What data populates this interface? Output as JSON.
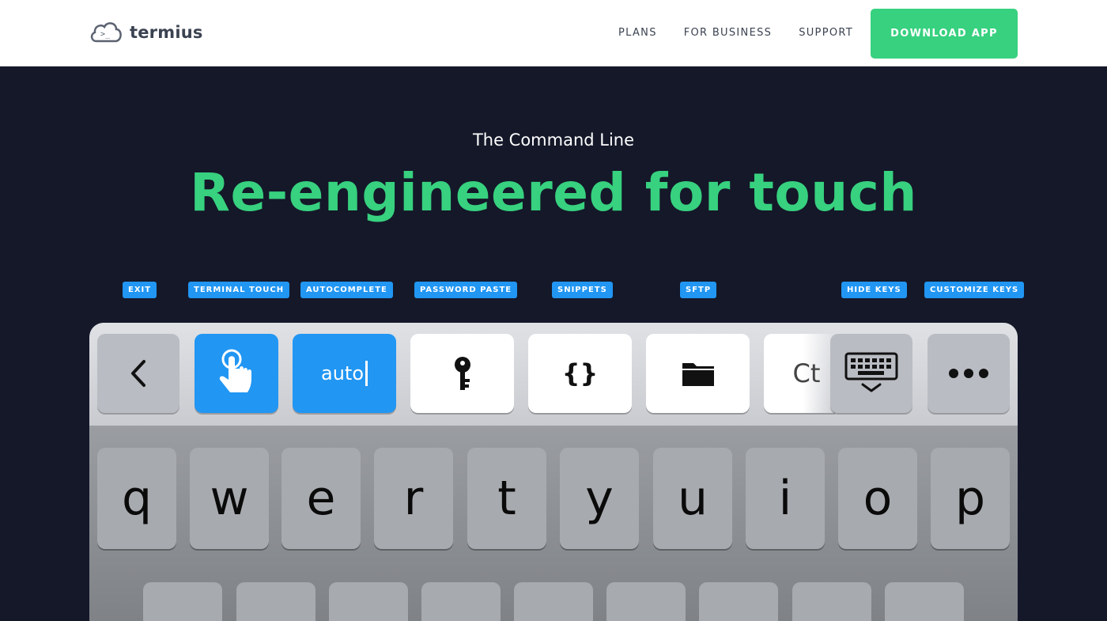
{
  "header": {
    "logo_text": "termius",
    "nav": [
      "PLANS",
      "FOR BUSINESS",
      "SUPPORT"
    ],
    "cta": "DOWNLOAD APP"
  },
  "hero": {
    "eyebrow": "The Command Line",
    "title": "Re-engineered for touch"
  },
  "feature_tags": [
    "EXIT",
    "TERMINAL TOUCH",
    "AUTOCOMPLETE",
    "PASSWORD PASTE",
    "SNIPPETS",
    "SFTP",
    "HIDE KEYS",
    "CUSTOMIZE KEYS"
  ],
  "accessory_keys": {
    "back_icon": "chevron-left-icon",
    "touch_icon": "tap-finger-icon",
    "autocomplete_text": "auto",
    "password_icon": "key-icon",
    "snippets_text": "{}",
    "sftp_icon": "folder-icon",
    "partial_text": "Ct",
    "hide_icon": "keyboard-hide-icon",
    "more_icon": "more-icon"
  },
  "keyboard_row1": [
    "q",
    "w",
    "e",
    "r",
    "t",
    "y",
    "u",
    "i",
    "o",
    "p"
  ],
  "colors": {
    "accent_green": "#37d17f",
    "accent_blue": "#2196f3",
    "background_dark": "#141829"
  }
}
